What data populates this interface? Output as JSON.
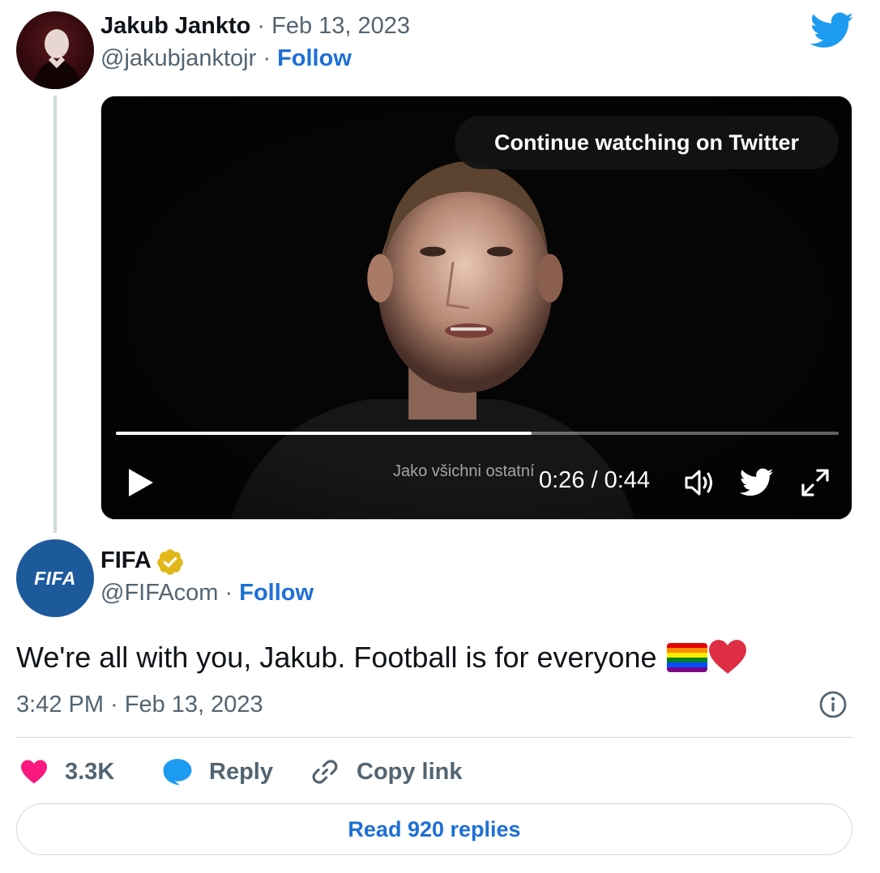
{
  "quoted_tweet": {
    "author_name": "Jakub Jankto",
    "separator": "·",
    "date": "Feb 13, 2023",
    "handle": "@jakubjanktojr",
    "follow_label": "Follow"
  },
  "video": {
    "continue_label": "Continue watching on Twitter",
    "subtitle": "Jako všichni ostatní",
    "current_time": "0:26",
    "time_separator": " / ",
    "duration": "0:44",
    "progress_fraction": 0.575
  },
  "tweet": {
    "author_name": "FIFA",
    "avatar_text": "FIFA",
    "handle": "@FIFAcom",
    "follow_label": "Follow",
    "text": "We're all with you, Jakub. Football is for everyone ",
    "emojis": [
      "rainbow-flag",
      "red-heart"
    ],
    "timestamp": "3:42 PM · Feb 13, 2023",
    "likes": "3.3K",
    "reply_label": "Reply",
    "copy_link_label": "Copy link",
    "read_replies_label": "Read 920 replies"
  },
  "colors": {
    "twitter_blue": "#1d9bf0",
    "link_blue": "#1d6fd6",
    "like_pink": "#f91880",
    "verified_gold": "#e2b719",
    "fifa_blue": "#1d5a9c",
    "muted_text": "#536471"
  },
  "icons": [
    "twitter-bird-icon",
    "play-icon",
    "volume-icon",
    "expand-icon",
    "verified-badge-icon",
    "info-icon",
    "heart-icon",
    "reply-bubble-icon",
    "link-icon"
  ]
}
